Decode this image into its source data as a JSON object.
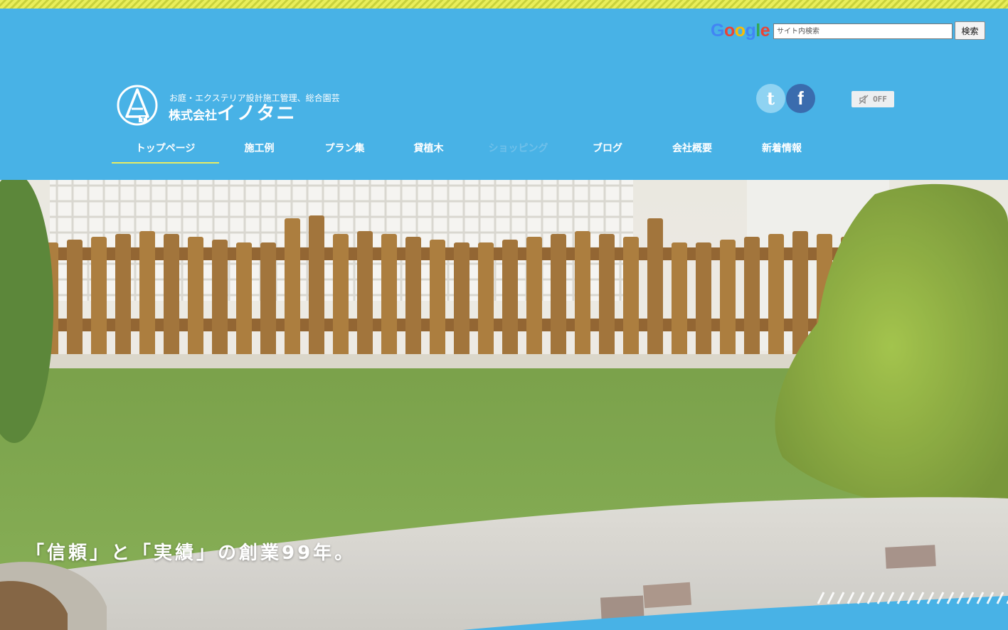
{
  "search": {
    "logo_letters": [
      "G",
      "o",
      "o",
      "g",
      "l",
      "e"
    ],
    "placeholder": "サイト内検索",
    "button_label": "検索"
  },
  "brand": {
    "tagline": "お庭・エクステリア設計施工管理、総合園芸",
    "name_prefix": "株式会社",
    "name_main": "イノタニ"
  },
  "social": {
    "tumblr_glyph": "t",
    "facebook_glyph": "f"
  },
  "sound": {
    "label": "OFF"
  },
  "nav": {
    "items": [
      {
        "label": "トップページ"
      },
      {
        "label": "施工例"
      },
      {
        "label": "プラン集"
      },
      {
        "label": "貸植木"
      },
      {
        "label": "ショッピング"
      },
      {
        "label": "ブログ"
      },
      {
        "label": "会社概要"
      },
      {
        "label": "新着情報"
      }
    ]
  },
  "hero": {
    "caption": "「信頼」と「実績」の創業99年。"
  },
  "colors": {
    "header_bg": "#48b2e6",
    "accent_underline": "#e8ec63",
    "stripe": "#e9ee5a",
    "facebook": "#3a6cae",
    "tumblr": "#8fd3f2"
  }
}
